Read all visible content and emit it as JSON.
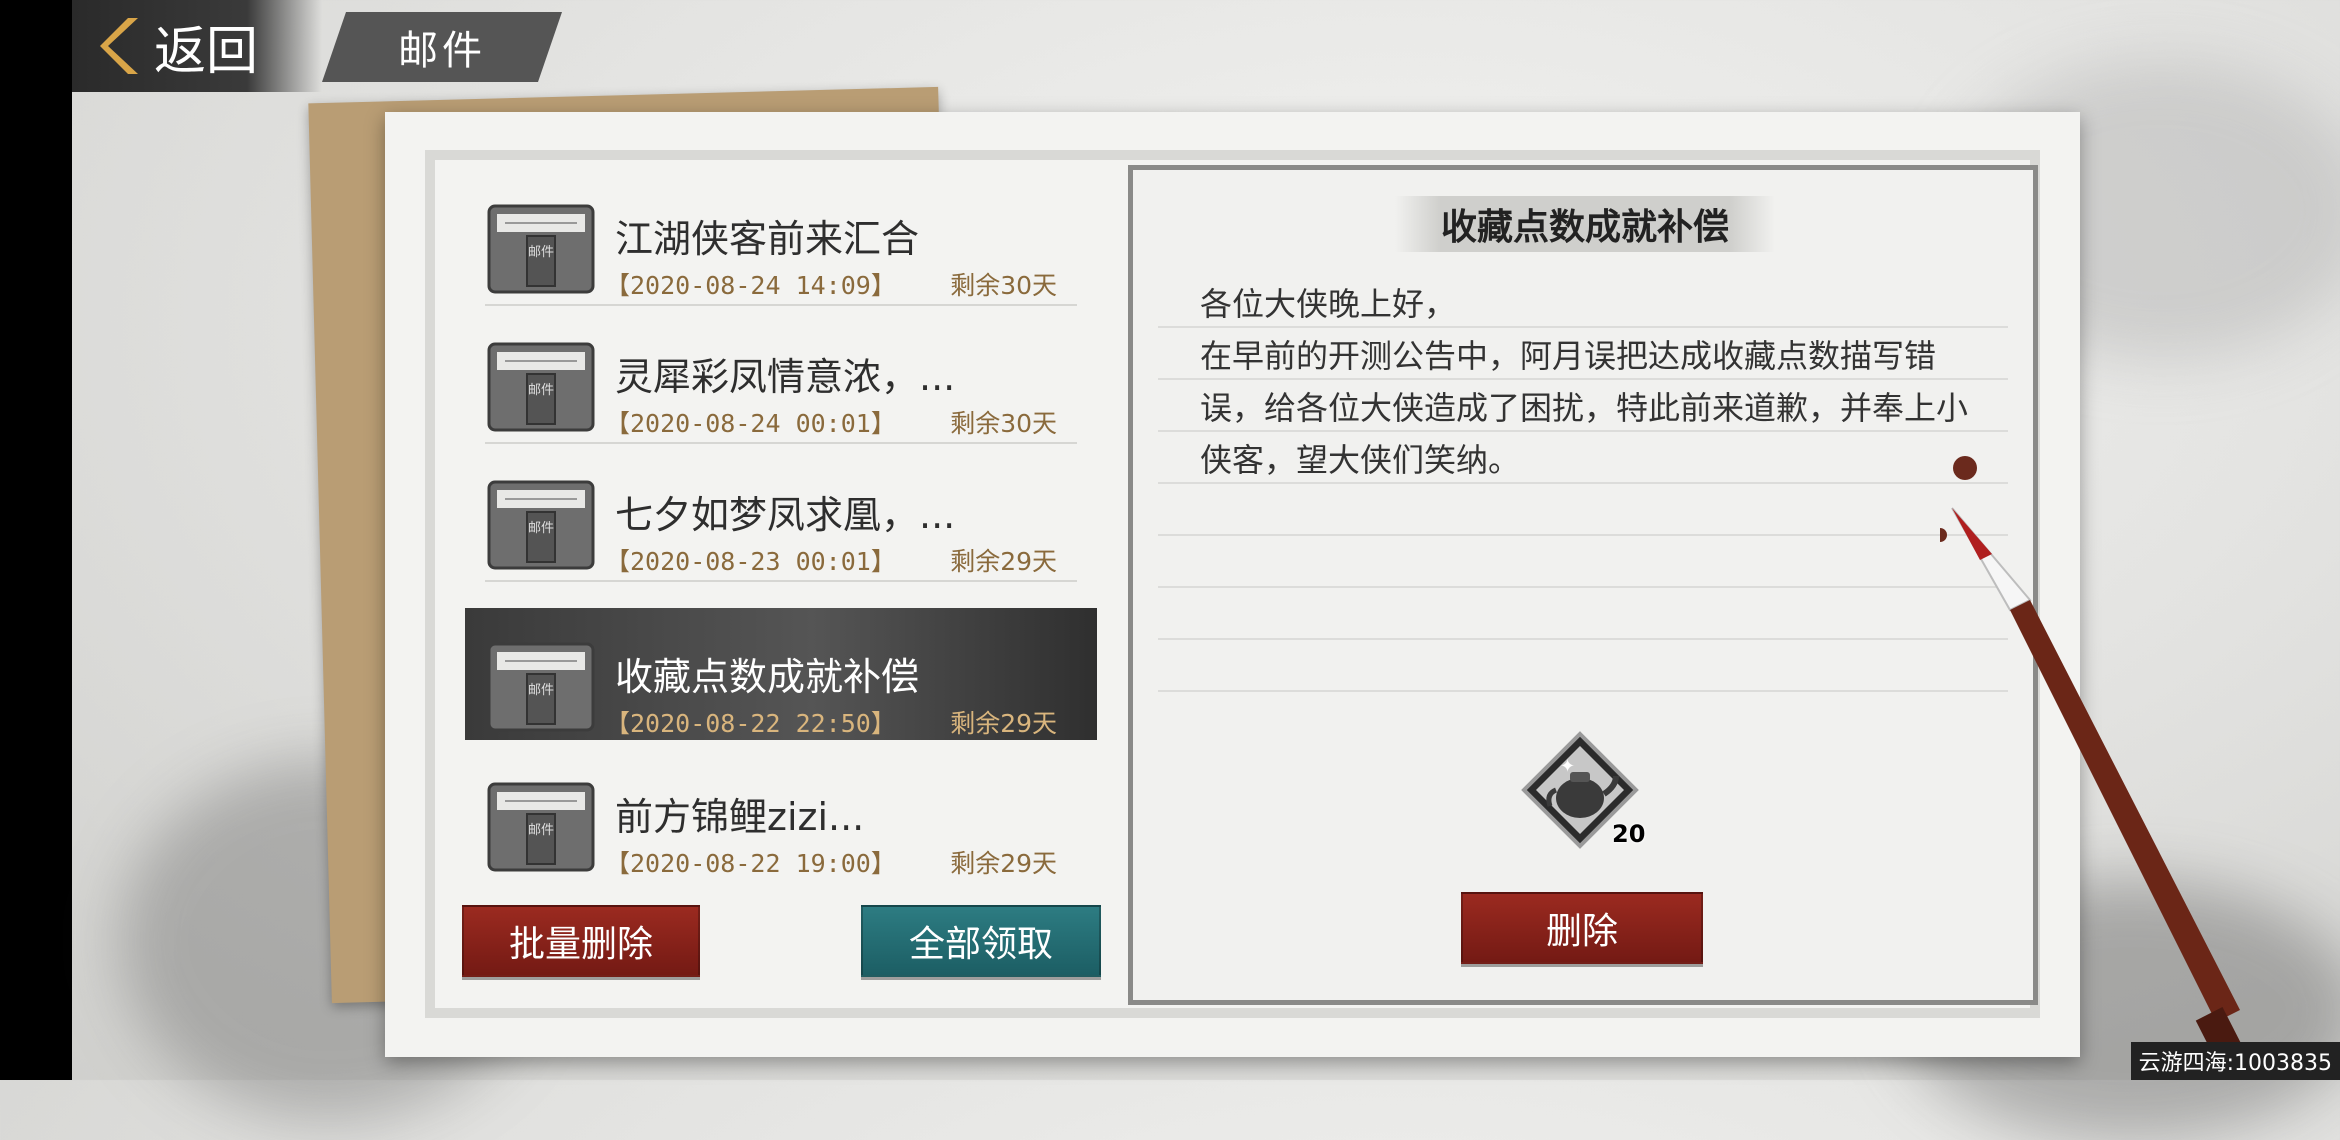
{
  "header": {
    "back_label": "返回",
    "title": "邮件"
  },
  "mail_list": {
    "items": [
      {
        "title": "江湖侠客前来汇合",
        "date": "【2020-08-24 14:09】",
        "remaining": "剩余30天",
        "selected": false
      },
      {
        "title": "灵犀彩凤情意浓，...",
        "date": "【2020-08-24 00:01】",
        "remaining": "剩余30天",
        "selected": false
      },
      {
        "title": "七夕如梦凤求凰，...",
        "date": "【2020-08-23 00:01】",
        "remaining": "剩余29天",
        "selected": false
      },
      {
        "title": "收藏点数成就补偿",
        "date": "【2020-08-22 22:50】",
        "remaining": "剩余29天",
        "selected": true
      },
      {
        "title": "前方锦鲤zizi...",
        "date": "【2020-08-22 19:00】",
        "remaining": "剩余29天",
        "selected": false
      }
    ],
    "icon_label": "邮件",
    "batch_delete_label": "批量删除",
    "claim_all_label": "全部领取"
  },
  "detail": {
    "title": "收藏点数成就补偿",
    "body": [
      "各位大侠晚上好，",
      "在早前的开测公告中，阿月误把达成收藏点数描写错误，给各位大侠造成了困扰，特此前来道歉，并奉上小侠客，望大侠们笑纳。"
    ],
    "reward": {
      "icon": "teapot-reward-icon",
      "count": "20"
    },
    "delete_label": "删除"
  },
  "watermark": "云游四海:1003835",
  "colors": {
    "accent_red": "#8a2219",
    "accent_teal": "#236b72",
    "date_brown": "#8a6a3c"
  }
}
